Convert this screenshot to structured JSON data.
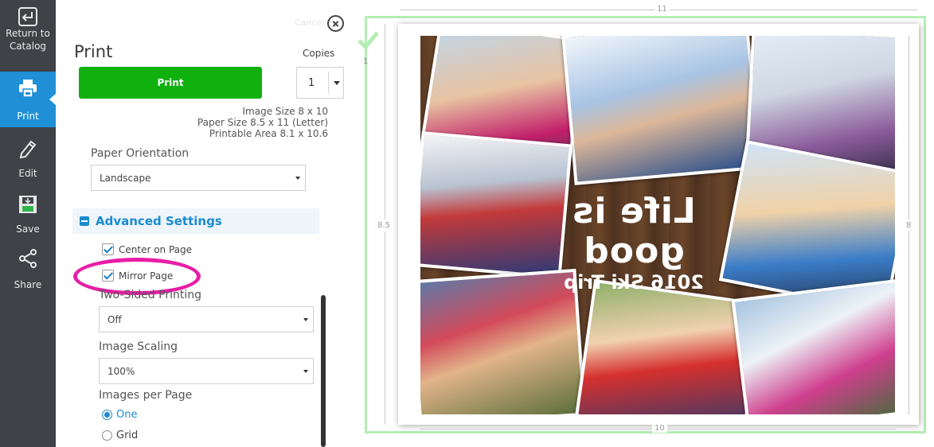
{
  "sidebar": {
    "items": [
      {
        "label": "Return to Catalog",
        "icon": "return-icon"
      },
      {
        "label": "Print",
        "icon": "printer-icon"
      },
      {
        "label": "Edit",
        "icon": "pencil-icon"
      },
      {
        "label": "Save",
        "icon": "save-icon"
      },
      {
        "label": "Share",
        "icon": "share-icon"
      }
    ],
    "active": "Print"
  },
  "panel": {
    "title": "Print",
    "cancel_label": "Cancel",
    "print_button": "Print",
    "copies": {
      "label": "Copies",
      "value": "1"
    },
    "image_size": "Image Size 8 x 10",
    "paper_size": "Paper Size 8.5 x 11 (Letter)",
    "printable_area": "Printable Area 8.1 x 10.6",
    "paper_orientation": {
      "label": "Paper Orientation",
      "value": "Landscape"
    },
    "advanced": {
      "title": "Advanced Settings",
      "center_on_page": {
        "label": "Center on Page",
        "checked": true
      },
      "mirror_page": {
        "label": "Mirror Page",
        "checked": true
      },
      "two_sided": {
        "label": "Two-Sided Printing",
        "value": "Off"
      },
      "image_scaling": {
        "label": "Image Scaling",
        "value": "100%"
      },
      "images_per_page": {
        "label": "Images per Page",
        "options": [
          "One",
          "Grid"
        ],
        "selected": "One"
      }
    }
  },
  "preview": {
    "page_number": "1",
    "dim_top": "11",
    "dim_bottom": "10",
    "dim_left": "8.5",
    "dim_right": "8",
    "design_text": {
      "main": "Life is good",
      "sub": "2016 Ski Trip"
    },
    "accent_colors": {
      "selection": "#b3edb3",
      "highlight": "#e81ea6",
      "print": "#10b10f",
      "link": "#1a8bd1"
    }
  }
}
